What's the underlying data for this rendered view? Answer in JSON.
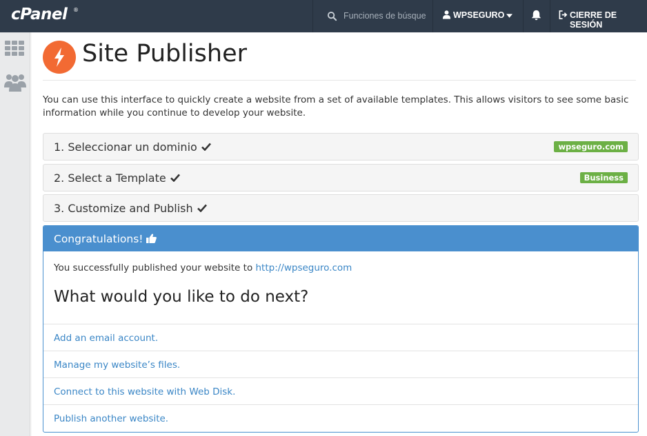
{
  "header": {
    "logo": "cPanel",
    "logo_mark": "®",
    "search_placeholder": "Funciones de búsque",
    "username": "WPSEGURO",
    "logout_label": "CIERRE DE SESIÓN"
  },
  "sidebar": {
    "icons": [
      "grid-icon",
      "users-icon"
    ]
  },
  "page": {
    "title": "Site Publisher",
    "intro": "You can use this interface to quickly create a website from a set of available templates. This allows visitors to see some basic information while you continue to develop your website."
  },
  "steps": [
    {
      "label": "1. Seleccionar un dominio",
      "badge": "wpseguro.com"
    },
    {
      "label": "2. Select a Template",
      "badge": "Business"
    },
    {
      "label": "3. Customize and Publish"
    }
  ],
  "panel": {
    "title": "Congratulations!",
    "success_text": "You successfully published your website to",
    "site_url": "http://wpseguro.com",
    "next_heading": "What would you like to do next?",
    "actions": [
      "Add an email account.",
      "Manage my website’s files.",
      "Connect to this website with Web Disk.",
      "Publish another website."
    ]
  },
  "colors": {
    "topbar": "#2f3b4a",
    "accent_orange": "#f26a33",
    "panel_blue": "#4a8fce",
    "link_blue": "#3a86c6",
    "badge_green": "#6cb045"
  }
}
